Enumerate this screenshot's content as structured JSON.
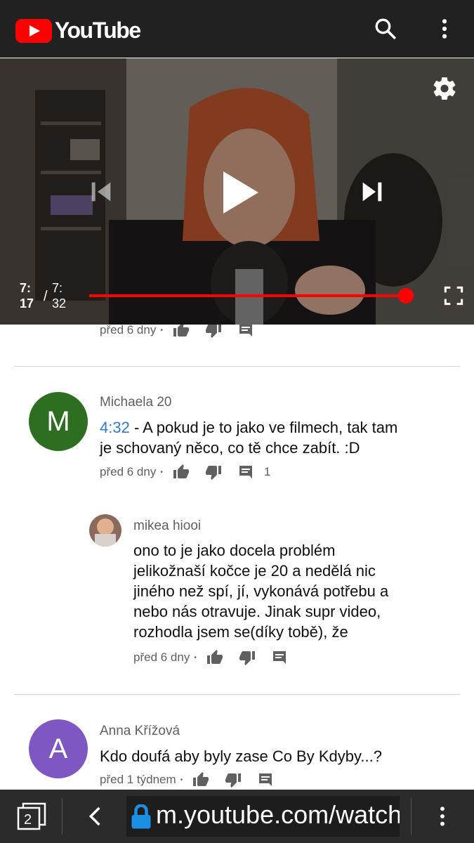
{
  "header": {
    "logo_text": "YouTube",
    "icons": [
      "search-icon",
      "more-vert-icon"
    ]
  },
  "player": {
    "current_time_line1": "7:",
    "current_time_line2": "17",
    "separator": "/",
    "duration_line1": "7:",
    "duration_line2": "32",
    "progress": 1.0,
    "colors": {
      "progress": "#ff0000"
    },
    "icons": [
      "settings-icon",
      "previous-icon",
      "play-icon",
      "next-icon",
      "fullscreen-icon"
    ]
  },
  "comments": {
    "partial_row": {
      "time": "před 6 dny"
    },
    "items": [
      {
        "avatar_letter": "M",
        "avatar_color": "#2e6e21",
        "author": "Michaela 20",
        "timestamp_link": "4:32",
        "text_line1": " - A pokud je to jako ve filmech, tak tam",
        "text_line2": "je schovaný něco, co tě chce zabít. :D",
        "time": "před 6 dny",
        "reply_count": "1"
      },
      {
        "author": "mikea hiooi",
        "text_lines": [
          "ono to je jako docela problém",
          "jelikožnaší kočce je 20 a nedělá nic",
          "jiného než spí, jí, vykonává potřebu a",
          "nebo nás otravuje. Jinak supr video,",
          "rozhodla jsem se(díky tobě), že"
        ],
        "time": "před 6 dny"
      },
      {
        "avatar_letter": "A",
        "avatar_color": "#7e57c2",
        "author": "Anna Křížová",
        "text": "Kdo doufá aby byly zase Co By Kdyby...?",
        "time": "před 1 týdnem"
      }
    ]
  },
  "browser": {
    "tab_count": "2",
    "url": "m.youtube.com/watch?v=",
    "icons": [
      "tabs-icon",
      "back-icon",
      "lock-icon",
      "more-vert-icon"
    ]
  }
}
